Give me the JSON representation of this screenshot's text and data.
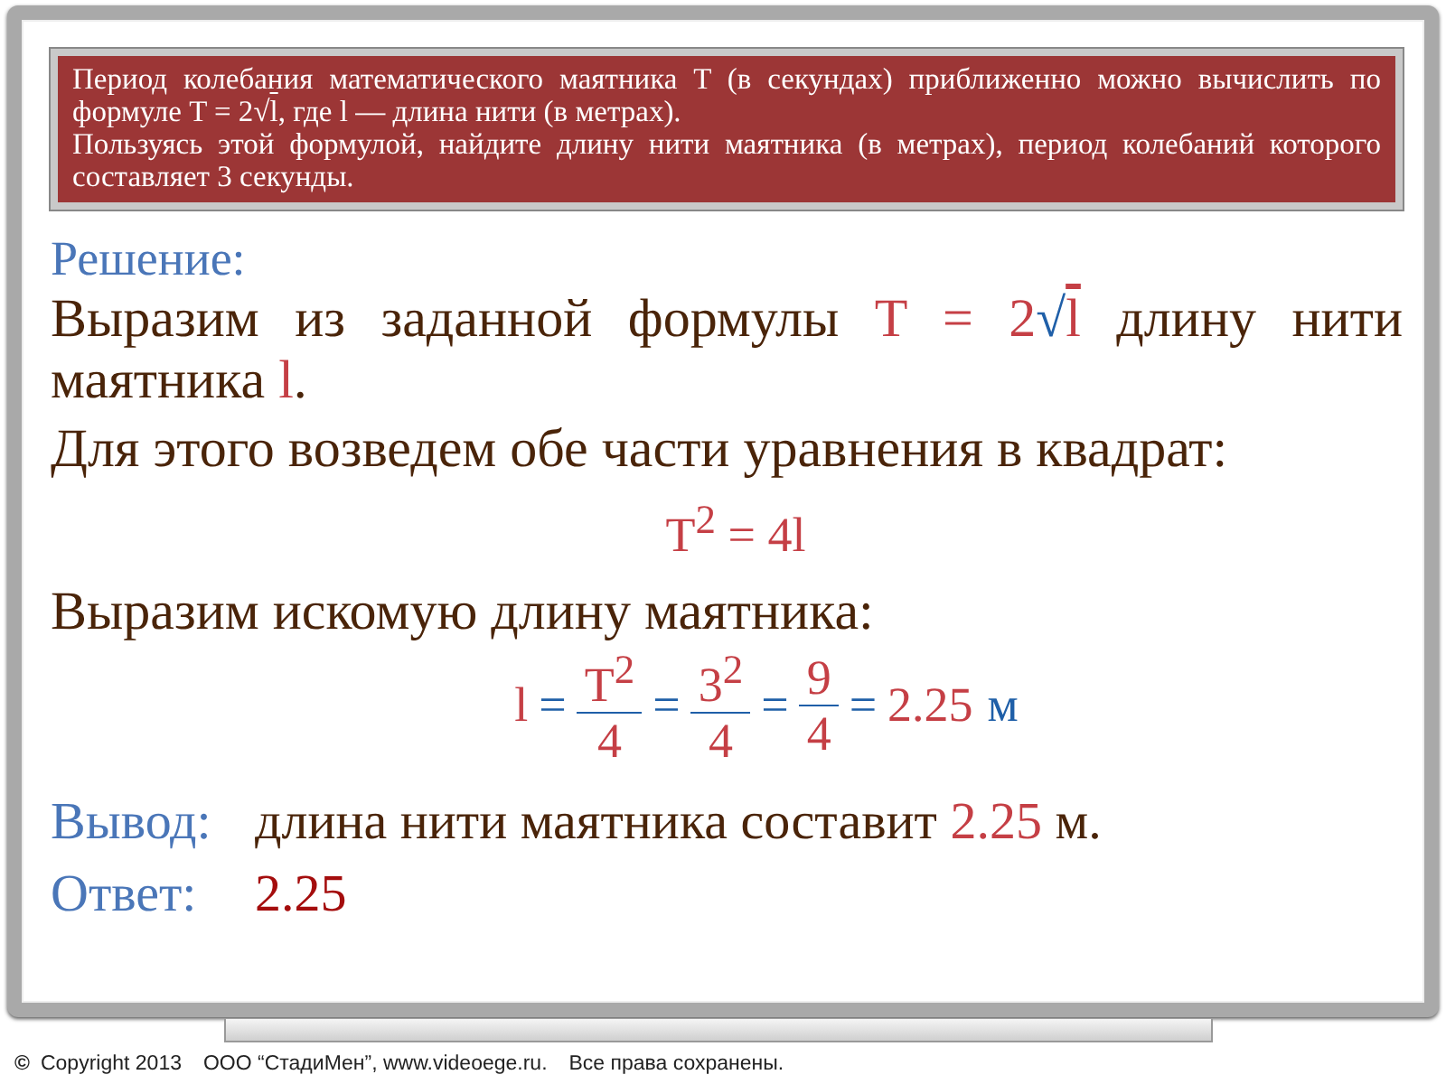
{
  "problem": {
    "paragraphs": [
      [
        {
          "kind": "plain",
          "text": "Период колебания математического маятника T (в секундах) приближенно можно вычислить по формуле T = 2"
        },
        {
          "kind": "radical",
          "sign": "√",
          "text": "l"
        },
        {
          "kind": "plain",
          "text": ", где l — длина нити (в метрах)."
        }
      ],
      [
        {
          "kind": "plain",
          "text": "Пользуясь этой формулой, найдите длину нити маятника (в метрах), период колебаний которого составляет 3 секунды."
        }
      ]
    ]
  },
  "solution": {
    "heading": "Решение:",
    "paragraphs": [
      {
        "kind": "text",
        "segments": [
          {
            "kind": "plain",
            "text": "Выразим из заданной формулы "
          },
          {
            "kind": "formula",
            "text": "T = 2"
          },
          {
            "kind": "radical",
            "sign": "√",
            "text": "l"
          },
          {
            "kind": "plain",
            "text": " длину нити маятника "
          },
          {
            "kind": "formula",
            "text": "l"
          },
          {
            "kind": "plain",
            "text": "."
          }
        ]
      },
      {
        "kind": "text",
        "segments": [
          {
            "kind": "plain",
            "text": "Для этого возведем обе части уравнения в квадрат:"
          }
        ]
      },
      {
        "kind": "equation",
        "segments": [
          {
            "kind": "formula",
            "text": "T$^{2}$ = 4l"
          }
        ]
      },
      {
        "kind": "text",
        "segments": [
          {
            "kind": "plain",
            "text": "Выразим искомую длину маятника:"
          }
        ]
      },
      {
        "kind": "fractions",
        "segments": [
          {
            "kind": "formula",
            "text": "l"
          },
          {
            "kind": "op",
            "text": "="
          },
          {
            "kind": "fraction",
            "num": "T$^{2}$",
            "den": "4"
          },
          {
            "kind": "op",
            "text": "="
          },
          {
            "kind": "fraction",
            "num": "3$^{2}$",
            "den": "4"
          },
          {
            "kind": "op",
            "text": "="
          },
          {
            "kind": "fraction",
            "num": "9",
            "den": "4"
          },
          {
            "kind": "op",
            "text": "="
          },
          {
            "kind": "formula",
            "text": "2.25"
          },
          {
            "kind": "unit",
            "text": "м"
          }
        ]
      }
    ]
  },
  "conclusion": {
    "label": "Вывод:",
    "segments": [
      {
        "kind": "plain",
        "text": "длина нити маятника составит "
      },
      {
        "kind": "formula",
        "text": "2.25"
      },
      {
        "kind": "plain",
        "text": " м."
      }
    ]
  },
  "answer": {
    "label": "Ответ:",
    "value": "2.25"
  },
  "footer": {
    "mark": "©",
    "parts": [
      "Copyright 2013",
      "ООО “СтадиМен”, www.videoege.ru.",
      "Все права сохранены."
    ]
  }
}
